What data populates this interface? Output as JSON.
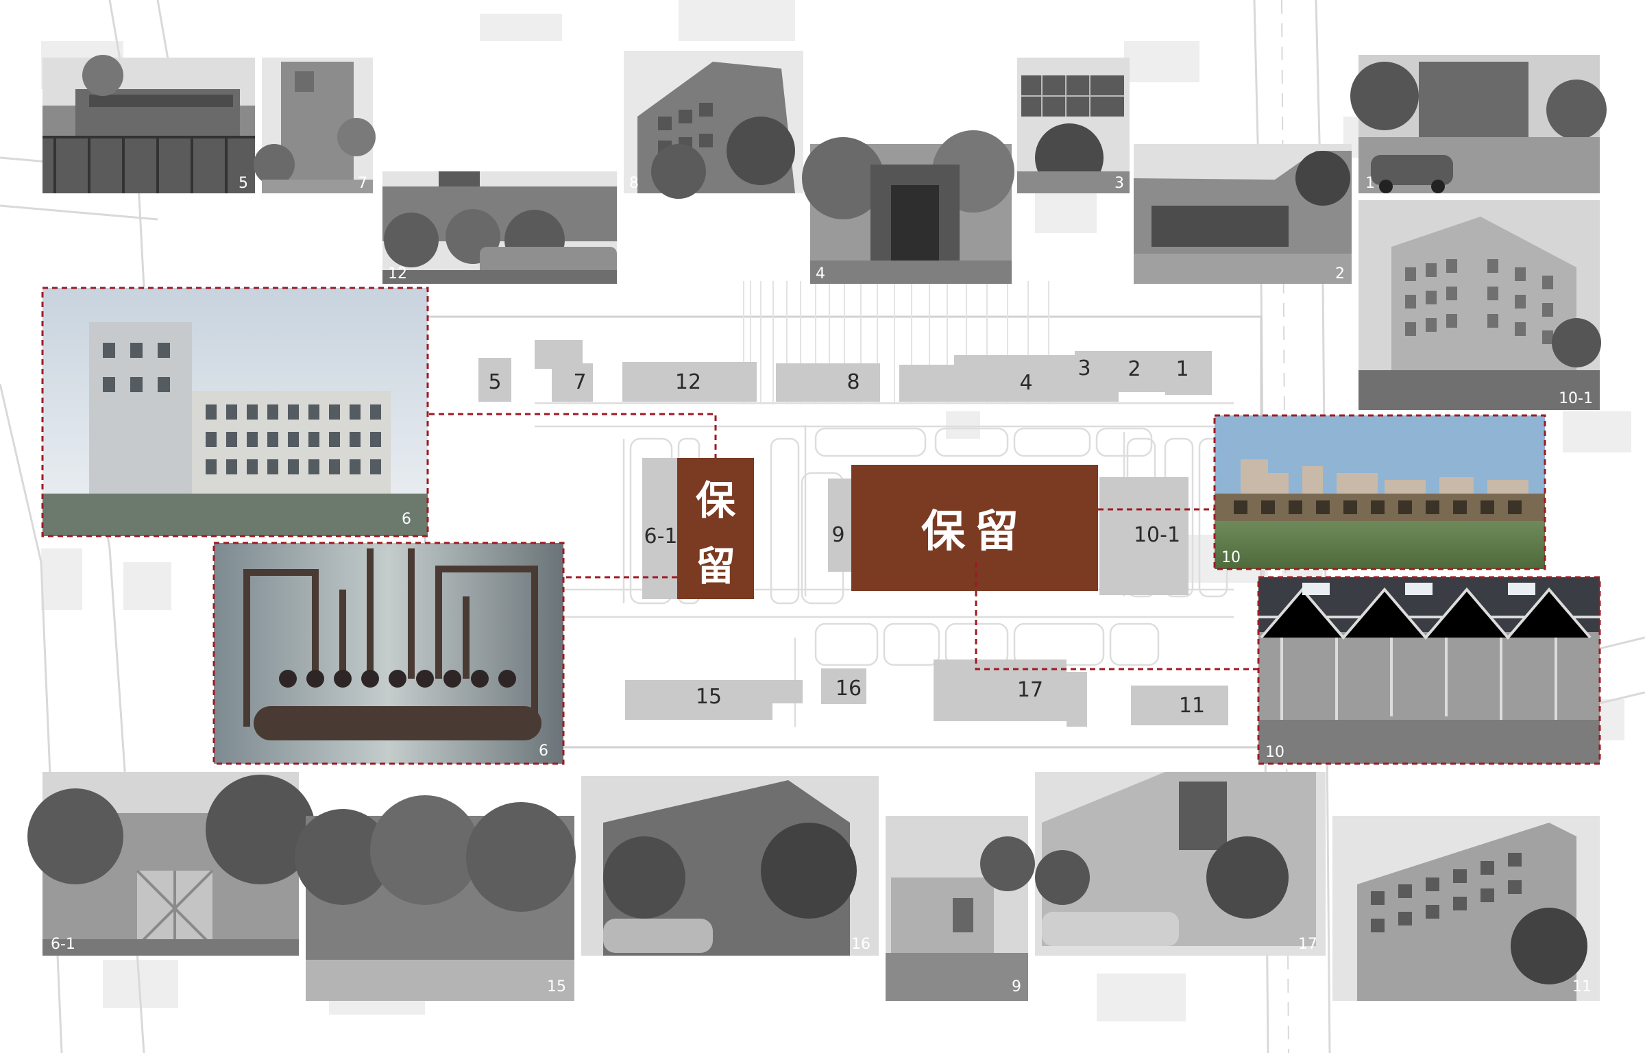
{
  "colors": {
    "accent": "#7b3a22",
    "leader": "#9e1a22",
    "building": "#c9c9c9",
    "road": "#e9e9e9"
  },
  "retain_label": "保留",
  "retain_label_vertical": [
    "保",
    "留"
  ],
  "buildings": [
    {
      "id": "5",
      "label": "5"
    },
    {
      "id": "7",
      "label": "7"
    },
    {
      "id": "12",
      "label": "12"
    },
    {
      "id": "8",
      "label": "8"
    },
    {
      "id": "4",
      "label": "4"
    },
    {
      "id": "3",
      "label": "3"
    },
    {
      "id": "2",
      "label": "2"
    },
    {
      "id": "1",
      "label": "1"
    },
    {
      "id": "6-1",
      "label": "6-1"
    },
    {
      "id": "9",
      "label": "9"
    },
    {
      "id": "10-1",
      "label": "10-1"
    },
    {
      "id": "15",
      "label": "15"
    },
    {
      "id": "16",
      "label": "16"
    },
    {
      "id": "17",
      "label": "17"
    },
    {
      "id": "11",
      "label": "11"
    }
  ],
  "photos": [
    {
      "id": "p5",
      "label": "5",
      "highlight": false
    },
    {
      "id": "p7",
      "label": "7",
      "highlight": false
    },
    {
      "id": "p12",
      "label": "12",
      "highlight": false
    },
    {
      "id": "p8",
      "label": "8",
      "highlight": false
    },
    {
      "id": "p4",
      "label": "4",
      "highlight": false
    },
    {
      "id": "p3",
      "label": "3",
      "highlight": false
    },
    {
      "id": "p2",
      "label": "2",
      "highlight": false
    },
    {
      "id": "p1",
      "label": "1",
      "highlight": false
    },
    {
      "id": "p10-1",
      "label": "10-1",
      "highlight": false
    },
    {
      "id": "p6",
      "label": "6",
      "highlight": true
    },
    {
      "id": "p6b",
      "label": "6",
      "highlight": true
    },
    {
      "id": "p10",
      "label": "10",
      "highlight": true
    },
    {
      "id": "p10b",
      "label": "10",
      "highlight": true
    },
    {
      "id": "p6-1",
      "label": "6-1",
      "highlight": false
    },
    {
      "id": "p15",
      "label": "15",
      "highlight": false
    },
    {
      "id": "p16",
      "label": "16",
      "highlight": false
    },
    {
      "id": "p9",
      "label": "9",
      "highlight": false
    },
    {
      "id": "p17",
      "label": "17",
      "highlight": false
    },
    {
      "id": "p11",
      "label": "11",
      "highlight": false
    }
  ]
}
